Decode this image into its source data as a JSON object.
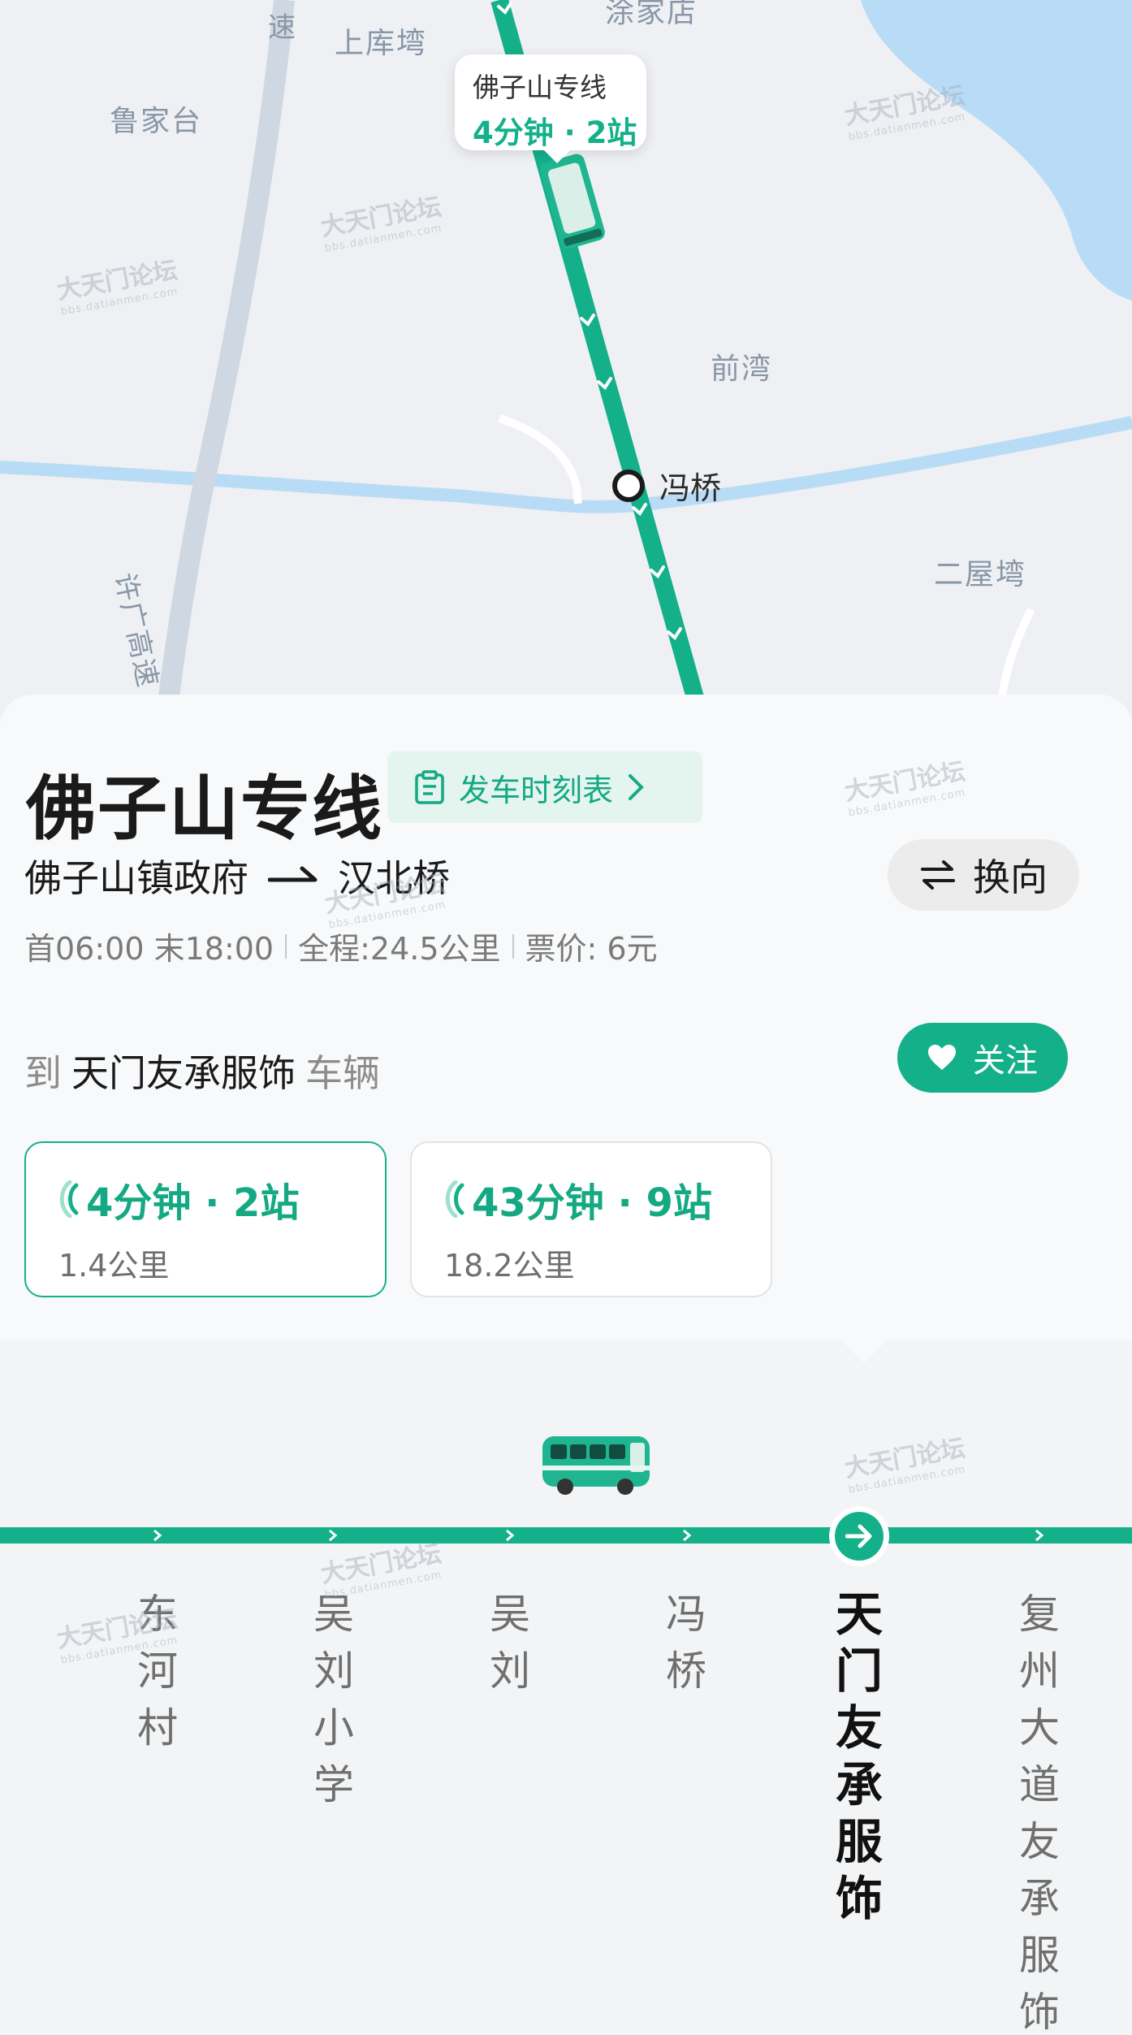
{
  "map": {
    "places": [
      "上库塆",
      "鲁家台",
      "前湾",
      "二屋塆",
      "许广高速",
      "涂家店",
      "速"
    ],
    "bubble": {
      "name": "佛子山专线",
      "eta": "4分钟 · 2站"
    },
    "stop_label": "冯桥",
    "watermark": "大天门论坛",
    "watermark_url": "bbs.datianmen.com"
  },
  "route": {
    "name": "佛子山专线",
    "timetable_label": "发车时刻表",
    "from": "佛子山镇政府",
    "to": "汉北桥",
    "switch_label": "换向",
    "first_last": "首06:00 末18:00",
    "total": "全程:24.5公里",
    "fare": "票价: 6元"
  },
  "destination": {
    "to_label": "到",
    "stop": "天门友承服饰",
    "vehicle_label": "车辆"
  },
  "follow_label": "关注",
  "arrivals": [
    {
      "eta": "4分钟 · 2站",
      "distance": "1.4公里"
    },
    {
      "eta": "43分钟 · 9站",
      "distance": "18.2公里"
    }
  ],
  "stations": [
    {
      "name": "东河村"
    },
    {
      "name": "吴刘小学"
    },
    {
      "name": "吴刘"
    },
    {
      "name": "冯桥"
    },
    {
      "name": "天门友承服饰"
    },
    {
      "name": "复州大道友承服饰"
    }
  ],
  "colors": {
    "accent": "#14b08a",
    "water": "#b9dcf6",
    "road": "#cfd8e2"
  }
}
